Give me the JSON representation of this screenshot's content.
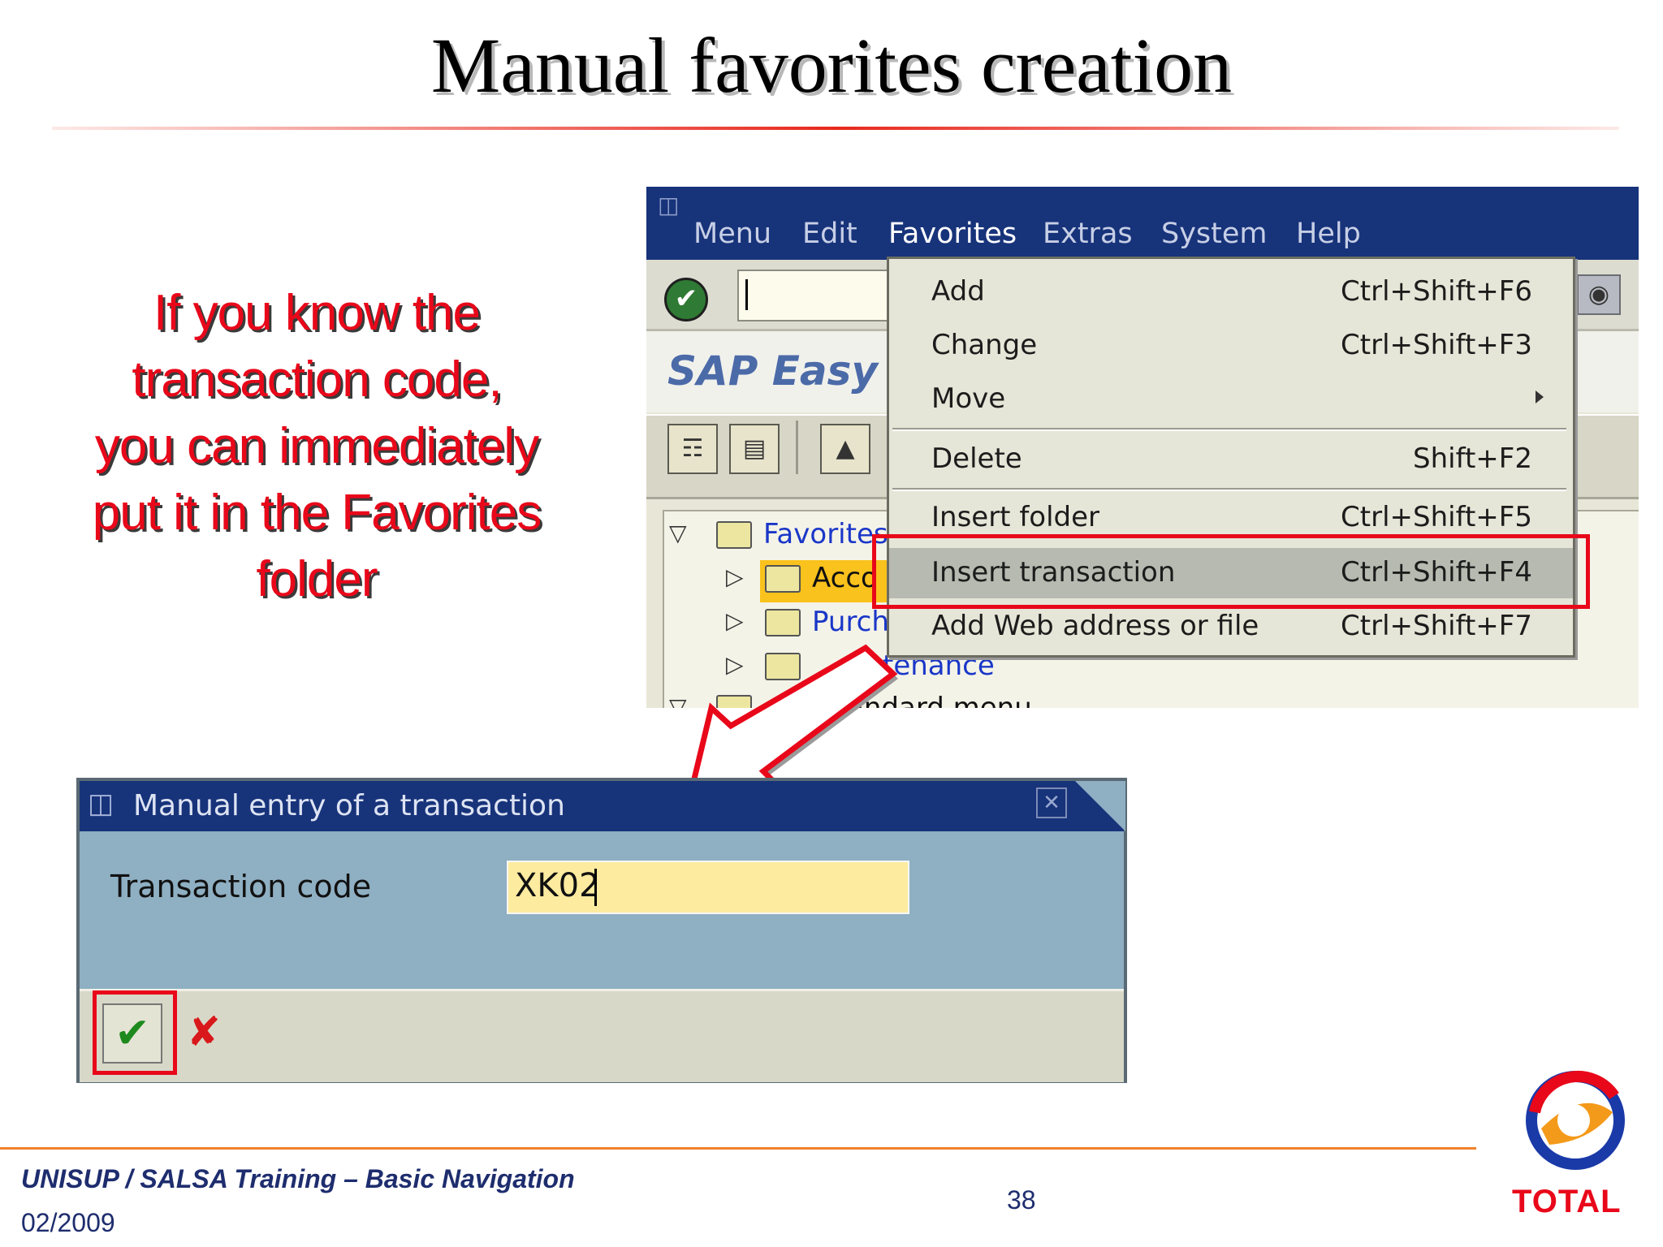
{
  "slide": {
    "title": "Manual favorites creation",
    "explanation_lines": [
      "If you know the",
      "transaction code,",
      "you can immediately",
      "put it in the Favorites",
      "folder"
    ]
  },
  "sap": {
    "menubar": [
      "Menu",
      "Edit",
      "Favorites",
      "Extras",
      "System",
      "Help"
    ],
    "easy_access_text": "SAP Easy A",
    "tree": {
      "root": "Favorites",
      "children": [
        "Acco",
        "Purch",
        "intenance"
      ],
      "next_root": "standard menu"
    },
    "favorites_menu": [
      {
        "label": "Add",
        "shortcut": "Ctrl+Shift+F6"
      },
      {
        "label": "Change",
        "shortcut": "Ctrl+Shift+F3"
      },
      {
        "label": "Move",
        "shortcut": ""
      },
      {
        "label": "Delete",
        "shortcut": "Shift+F2"
      },
      {
        "label": "Insert folder",
        "shortcut": "Ctrl+Shift+F5"
      },
      {
        "label": "Insert transaction",
        "shortcut": "Ctrl+Shift+F4"
      },
      {
        "label": "Add Web address or file",
        "shortcut": "Ctrl+Shift+F7"
      }
    ]
  },
  "dialog": {
    "title": "Manual entry of a transaction",
    "field_label": "Transaction code",
    "field_value": "XK02"
  },
  "footer": {
    "course": "UNISUP / SALSA Training – Basic Navigation",
    "date": "02/2009",
    "page": "38",
    "logo_text": "TOTAL"
  },
  "colors": {
    "highlight_red": "#e8081a",
    "sap_blue": "#17337a",
    "footer_orange": "#f0822a"
  }
}
